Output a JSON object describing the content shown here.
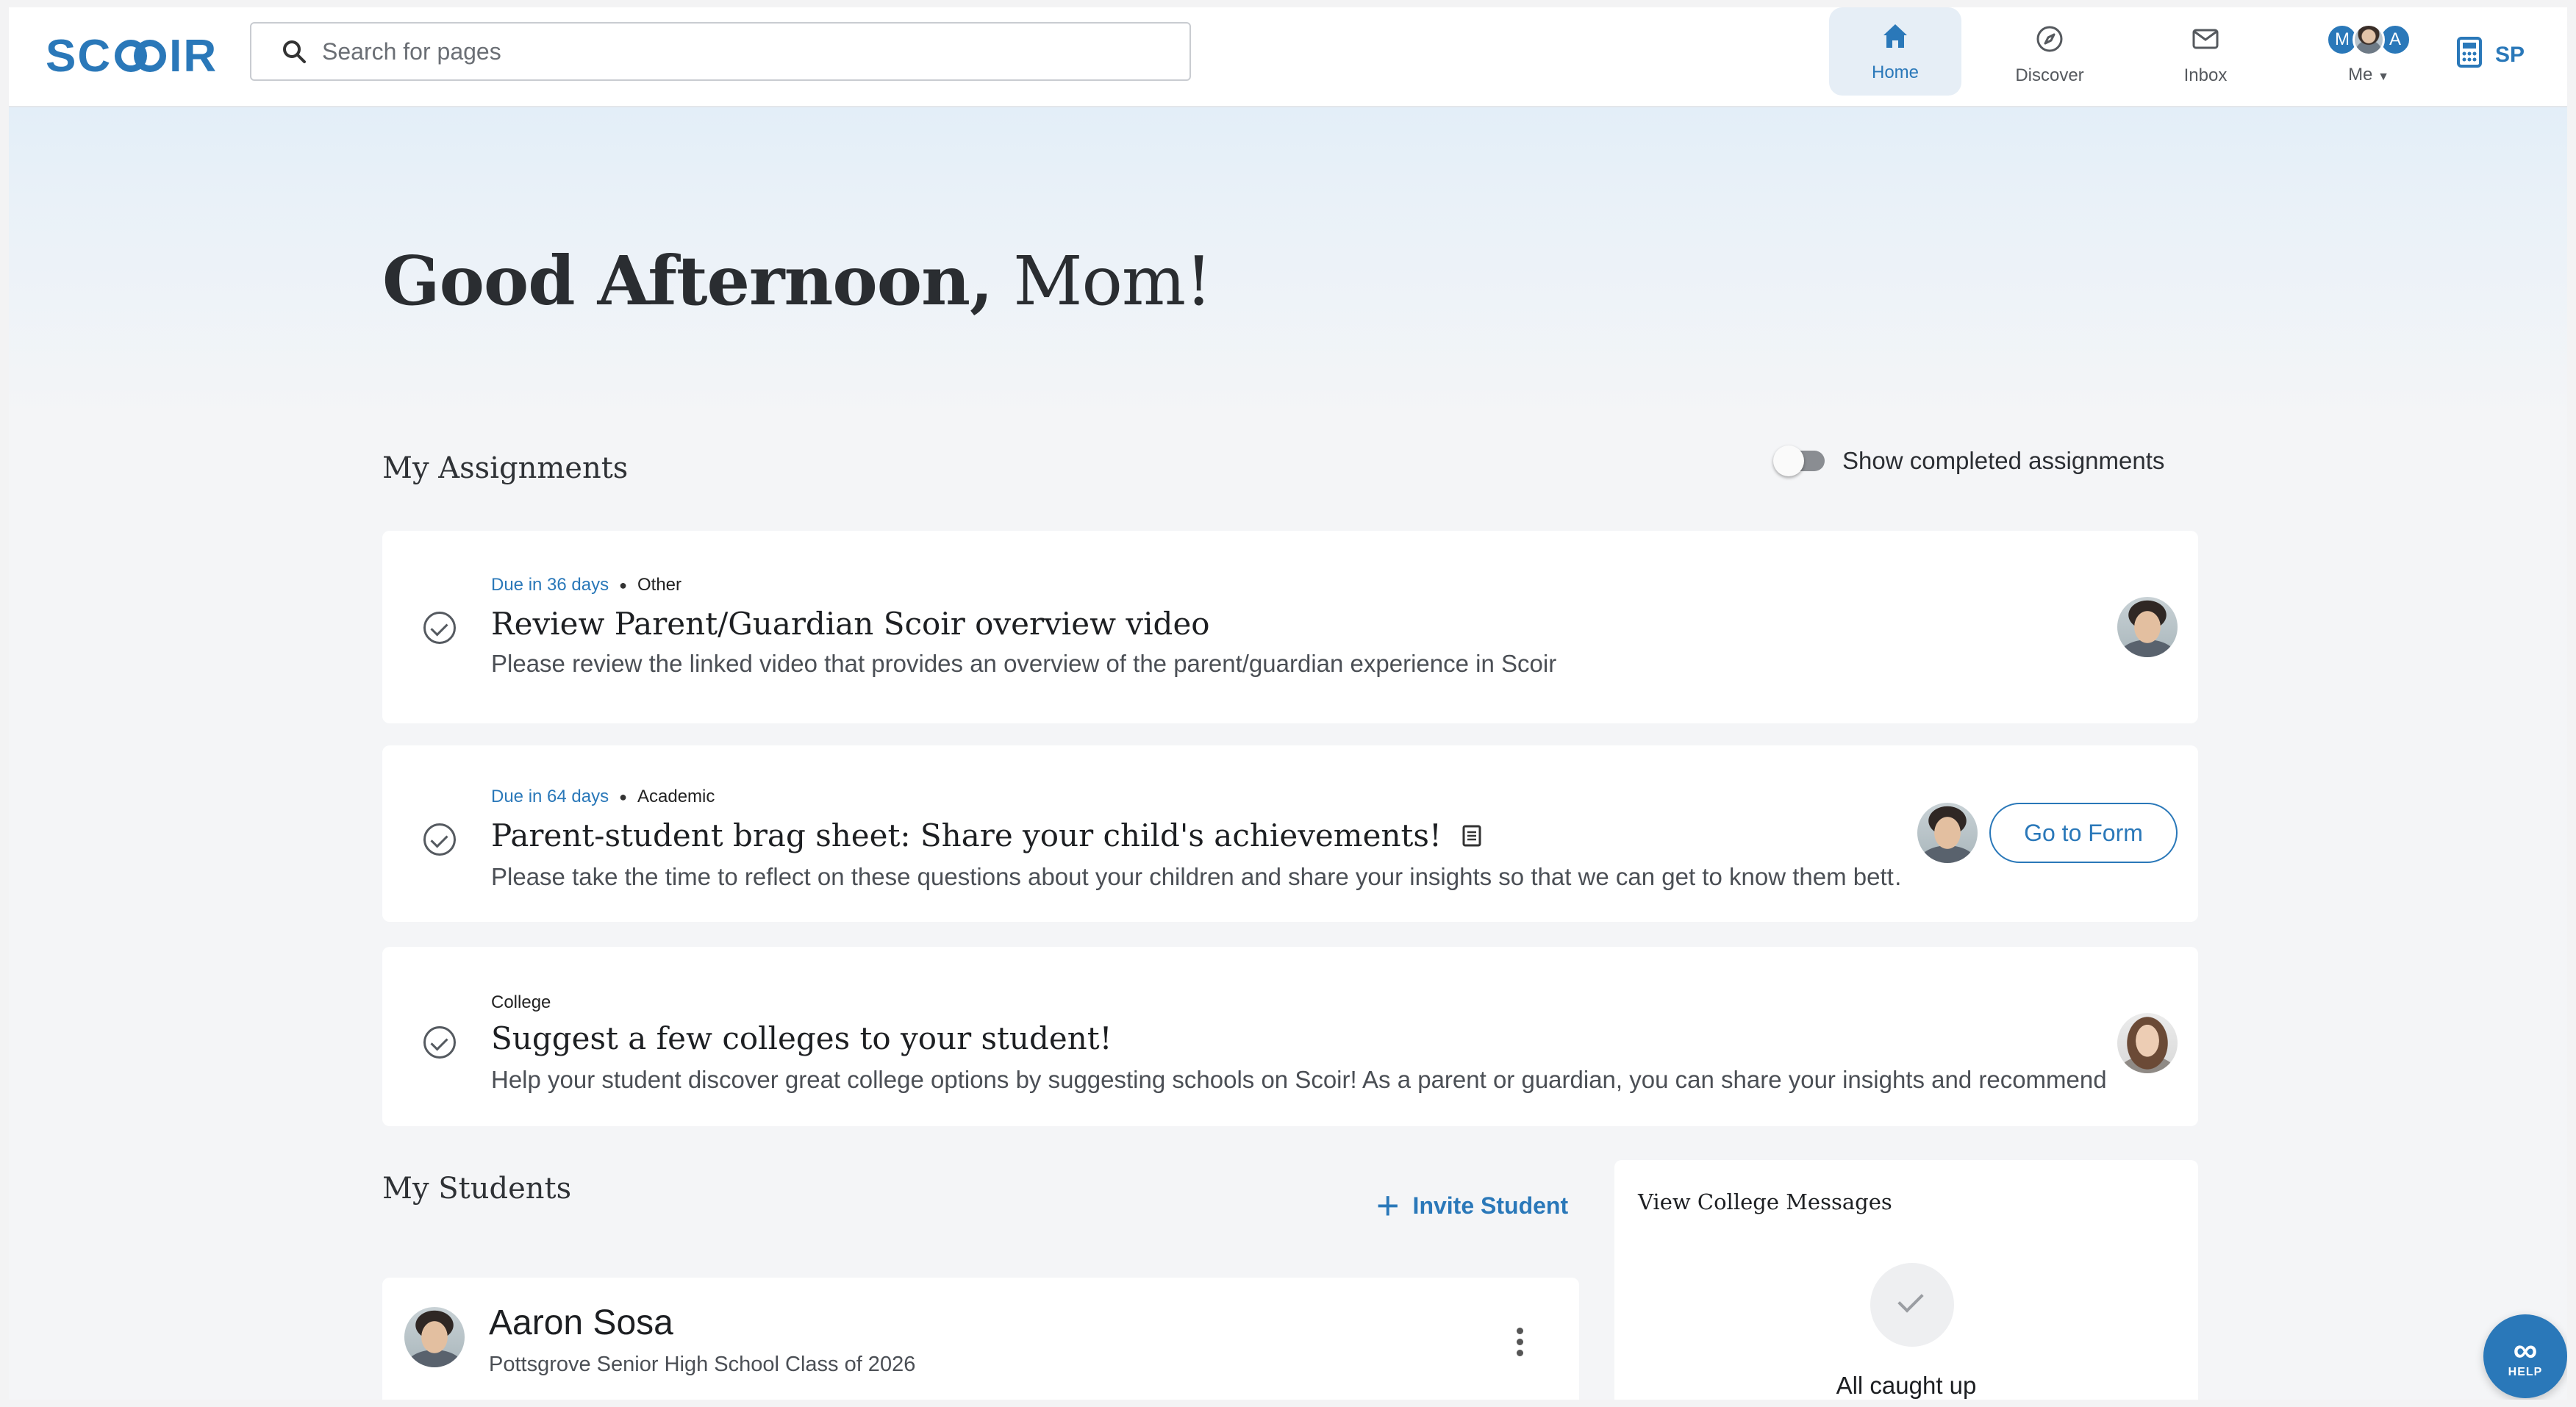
{
  "brand": {
    "logo_text_left": "SC",
    "logo_text_right": "IR",
    "accent": "#2a78b9"
  },
  "search": {
    "placeholder": "Search for pages"
  },
  "nav": {
    "home": "Home",
    "discover": "Discover",
    "inbox": "Inbox",
    "me": "Me",
    "me_avatar_left": "M",
    "me_avatar_right": "A",
    "sp": "SP"
  },
  "greeting": {
    "prefix": "Good Afternoon,",
    "name": "Mom!"
  },
  "assignments": {
    "title": "My Assignments",
    "toggle_label": "Show completed assignments",
    "items": [
      {
        "due": "Due in 36 days",
        "category": "Other",
        "title": "Review Parent/Guardian Scoir overview video",
        "description": "Please review the linked video that provides an overview of the parent/guardian experience in Scoir"
      },
      {
        "due": "Due in 64 days",
        "category": "Academic",
        "title": "Parent-student brag sheet: Share your child's achievements!",
        "description": "Please take the time to reflect on these questions about your children and share your insights so that we can get to know them bett…",
        "action": "Go to Form"
      },
      {
        "due": "",
        "category": "College",
        "title": "Suggest a few colleges to your student!",
        "description": "Help your student discover great college options by suggesting schools on Scoir! As a parent or guardian, you can share your insights and recommend…"
      }
    ]
  },
  "students": {
    "title": "My Students",
    "invite_label": "Invite Student",
    "list": [
      {
        "name": "Aaron Sosa",
        "school": "Pottsgrove Senior High School Class of 2026"
      }
    ]
  },
  "college_messages": {
    "title": "View College Messages",
    "status": "All caught up"
  },
  "help": {
    "label": "HELP"
  }
}
